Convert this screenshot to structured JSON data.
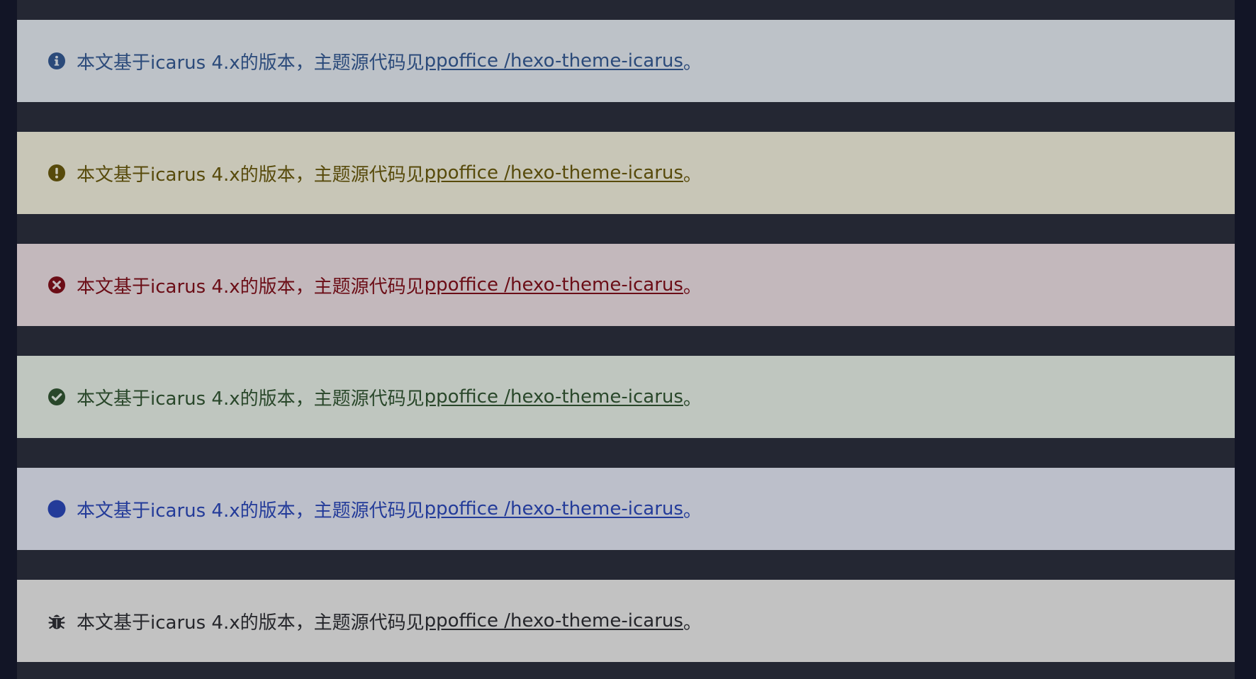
{
  "notes": [
    {
      "variant": "info",
      "icon": "info-circle-icon",
      "text": "本文基于icarus 4.x的版本，主题源代码见 ",
      "link": "ppoffice /hexo-theme-icarus",
      "suffix": "。",
      "color": "#2b4a7a",
      "background": "#bdc2c8"
    },
    {
      "variant": "warning",
      "icon": "exclamation-circle-icon",
      "text": "本文基于icarus 4.x的版本，主题源代码见 ",
      "link": "ppoffice /hexo-theme-icarus",
      "suffix": "。",
      "color": "#574a0b",
      "background": "#c8c6b7"
    },
    {
      "variant": "danger",
      "icon": "times-circle-icon",
      "text": "本文基于icarus 4.x的版本，主题源代码见 ",
      "link": "ppoffice /hexo-theme-icarus",
      "suffix": "。",
      "color": "#6b0d16",
      "background": "#c3b8bc"
    },
    {
      "variant": "success",
      "icon": "check-circle-icon",
      "text": "本文基于icarus 4.x的版本，主题源代码见 ",
      "link": "ppoffice /hexo-theme-icarus",
      "suffix": "。",
      "color": "#29472a",
      "background": "#bfc6bf"
    },
    {
      "variant": "primary",
      "icon": "circle-icon",
      "text": "本文基于icarus 4.x的版本，主题源代码见 ",
      "link": "ppoffice /hexo-theme-icarus",
      "suffix": "。",
      "color": "#233b99",
      "background": "#bcbfca"
    },
    {
      "variant": "dark",
      "icon": "bug-icon",
      "text": "本文基于icarus 4.x的版本，主题源代码见 ",
      "link": "ppoffice /hexo-theme-icarus",
      "suffix": "。",
      "color": "#25262b",
      "background": "#c2c2c2"
    }
  ],
  "colors": {
    "page_background": "#121526",
    "content_background": "#242733"
  }
}
